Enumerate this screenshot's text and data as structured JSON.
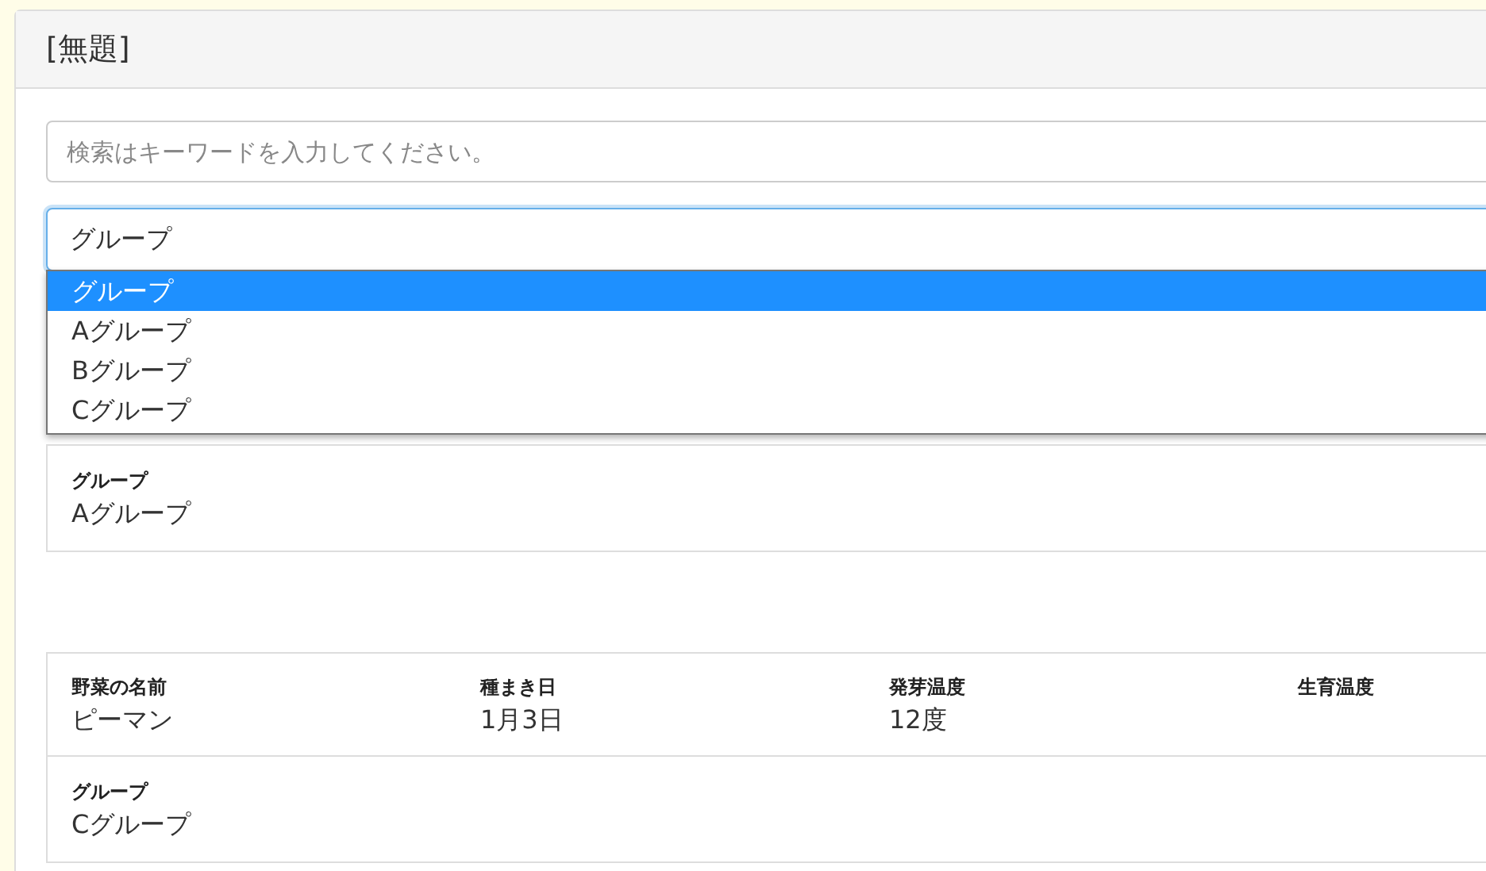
{
  "panel": {
    "title": "[無題]"
  },
  "search": {
    "placeholder": "検索はキーワードを入力してください。"
  },
  "group_select": {
    "value": "グループ",
    "expanded": true,
    "options": [
      {
        "label": "グループ",
        "selected": true
      },
      {
        "label": "Aグループ",
        "selected": false
      },
      {
        "label": "Bグループ",
        "selected": false
      },
      {
        "label": "Cグループ",
        "selected": false
      }
    ]
  },
  "records": [
    {
      "group": {
        "label": "グループ",
        "value": "Aグループ"
      }
    },
    {
      "fields": [
        {
          "label": "野菜の名前",
          "value": "ピーマン"
        },
        {
          "label": "種まき日",
          "value": "1月3日"
        },
        {
          "label": "発芽温度",
          "value": "12度"
        },
        {
          "label": "生育温度"
        }
      ],
      "group": {
        "label": "グループ",
        "value": "Cグループ"
      }
    }
  ]
}
